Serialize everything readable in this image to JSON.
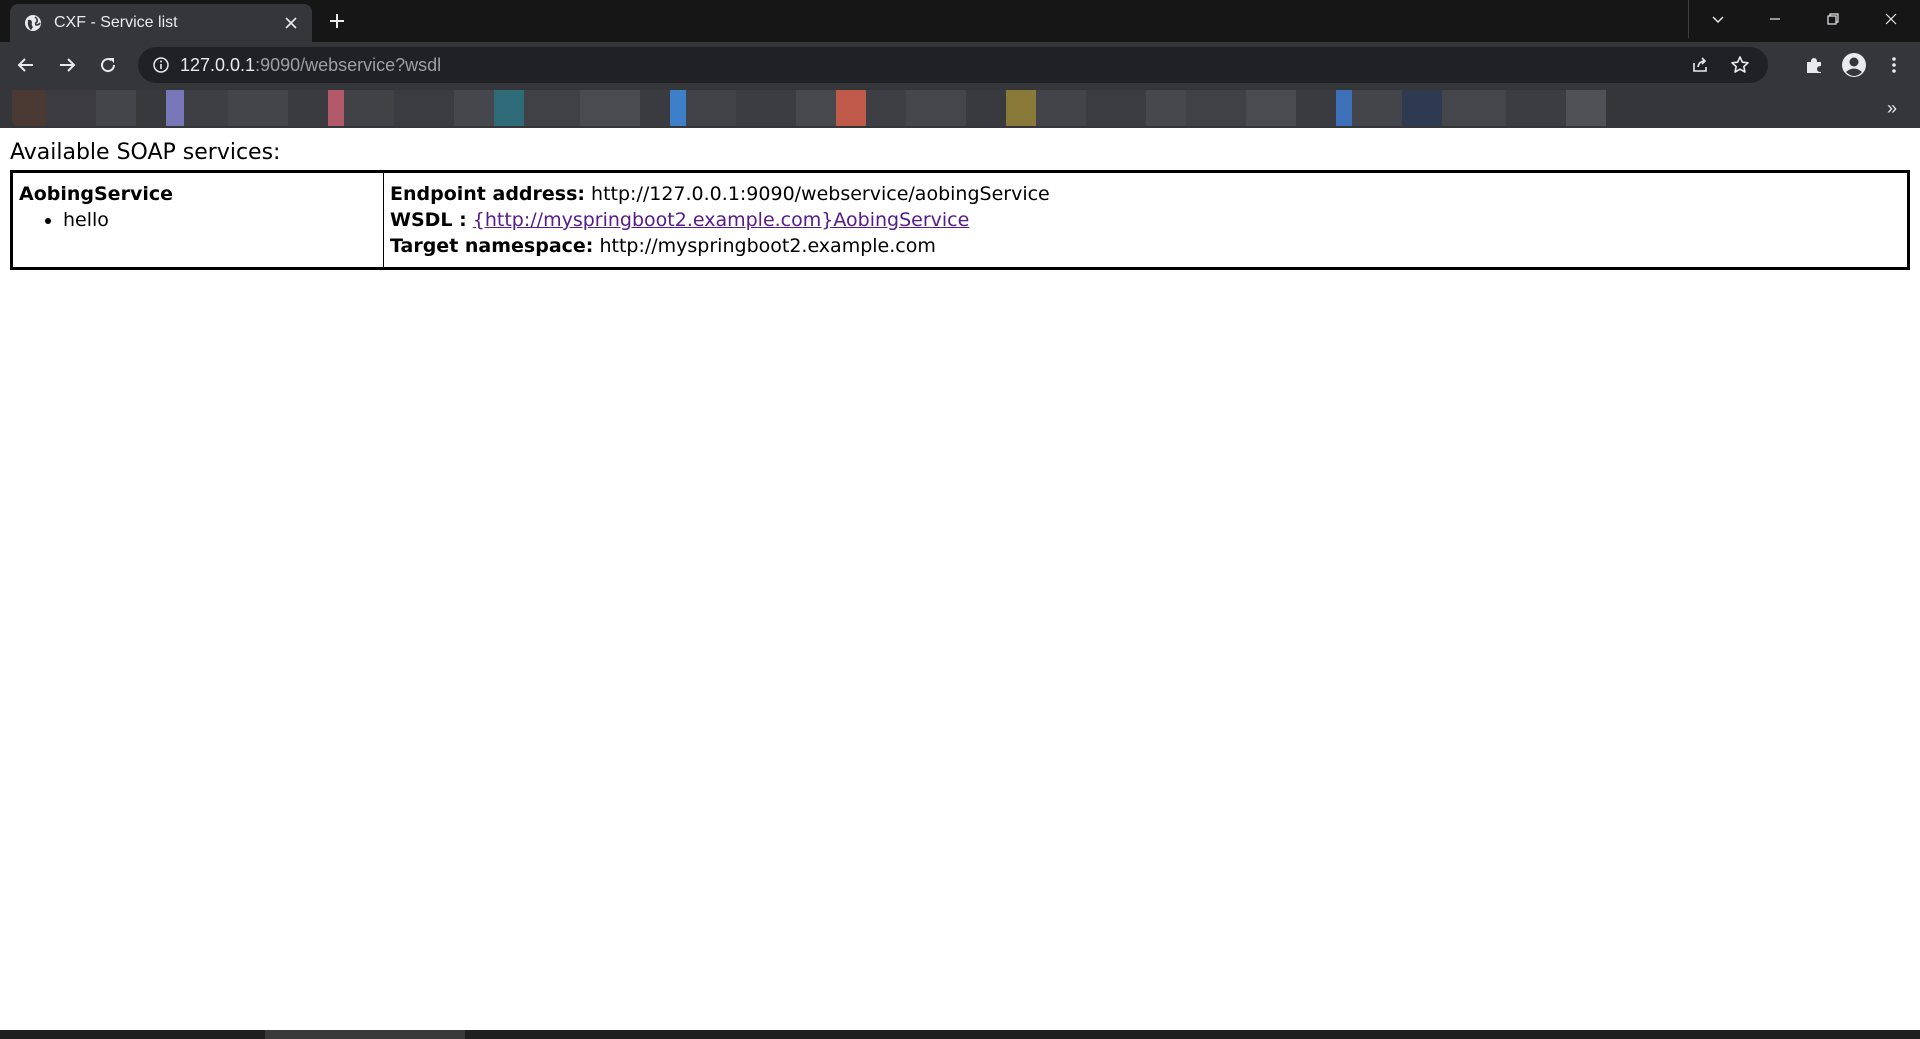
{
  "browser": {
    "tab": {
      "title": "CXF - Service list",
      "favicon": "globe-icon",
      "close_glyph": "✕"
    },
    "new_tab_glyph": "+",
    "address": {
      "host": "127.0.0.1",
      "path": ":9090/webservice?wsdl"
    },
    "bookmarks_overflow": "»",
    "colors": {
      "frame": "#202124",
      "toolbar": "#35363a",
      "text": "#e8eaed",
      "muted_text": "#9aa0a6"
    }
  },
  "page": {
    "heading": "Available SOAP services:",
    "services": [
      {
        "name": "AobingService",
        "operations": [
          "hello"
        ],
        "endpoint_label": "Endpoint address:",
        "endpoint_value": "http://127.0.0.1:9090/webservice/aobingService",
        "wsdl_label": "WSDL :",
        "wsdl_link": "{http://myspringboot2.example.com}AobingService",
        "namespace_label": "Target namespace:",
        "namespace_value": "http://myspringboot2.example.com"
      }
    ],
    "colors": {
      "link_visited": "#551a8b",
      "text": "#000000",
      "background": "#ffffff"
    }
  }
}
